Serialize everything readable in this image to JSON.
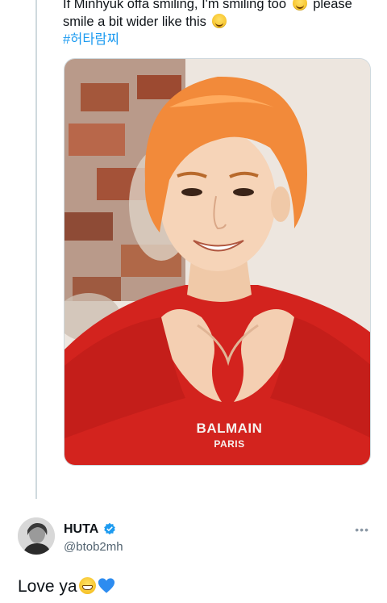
{
  "tweet": {
    "line1_a": "If Minhyuk offa smiling, I'm smiling too",
    "line1_b": "please",
    "line2": "smile a bit wider like this",
    "hashtag": "#허타람찌",
    "emoji_1": "smiling-face-icon",
    "emoji_2": "smiling-face-icon"
  },
  "photo": {
    "brand_line_1": "BALMAIN",
    "brand_line_2": "PARIS"
  },
  "reply": {
    "name": "HUTA",
    "handle": "@btob2mh",
    "more_label": "•••",
    "text": "Love ya",
    "emoji_grin": "grinning-face-icon",
    "emoji_heart": "blue-heart-icon"
  },
  "colors": {
    "link": "#1d9bf0",
    "text": "#0f1419",
    "secondary": "#536471",
    "thread_line": "#cfd9de",
    "sweater": "#d3231e",
    "hair": "#f28a3a"
  }
}
